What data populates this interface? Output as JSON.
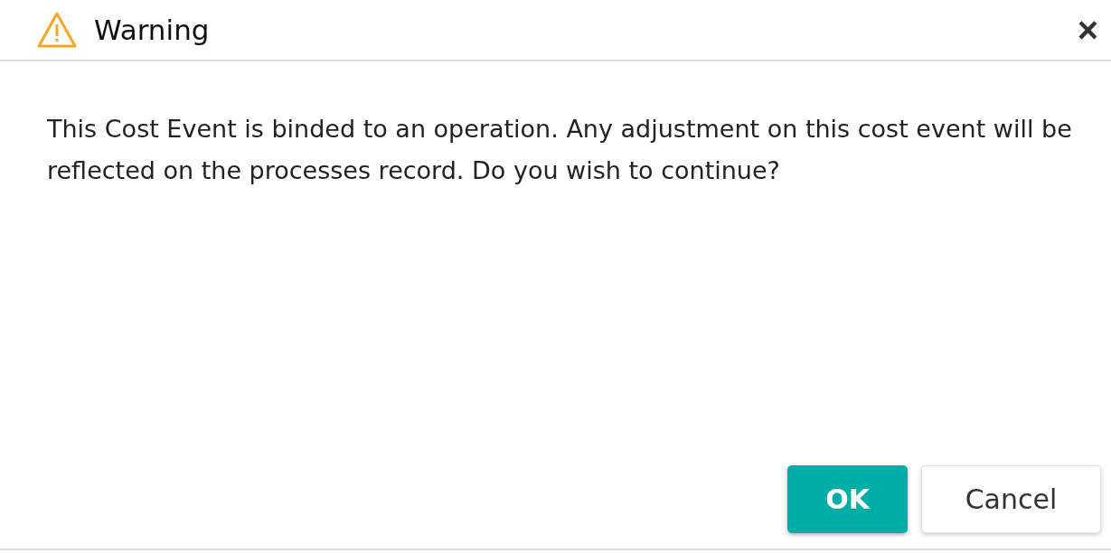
{
  "dialog": {
    "title": "Warning",
    "close": "×",
    "message": "This Cost Event is binded to an operation. Any adjustment on this cost event will be reflected on the processes record. Do you wish to continue?",
    "buttons": [
      {
        "label": "OK",
        "kind": "primary"
      },
      {
        "label": "Cancel",
        "kind": "secondary"
      }
    ]
  }
}
